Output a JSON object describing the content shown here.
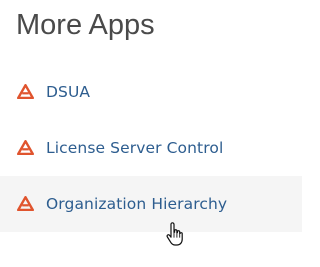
{
  "panel": {
    "title": "More Apps"
  },
  "apps": [
    {
      "label": "DSUA",
      "icon": "app-logo-icon"
    },
    {
      "label": "License Server Control",
      "icon": "app-logo-icon"
    },
    {
      "label": "Organization Hierarchy",
      "icon": "app-logo-icon"
    }
  ],
  "hovered_index": 2,
  "colors": {
    "title": "#4a4a4a",
    "link": "#2d5d8f",
    "logo": "#e0542e",
    "hover_bg": "#f5f5f5"
  },
  "cursor": {
    "icon": "hand-pointer-icon"
  }
}
